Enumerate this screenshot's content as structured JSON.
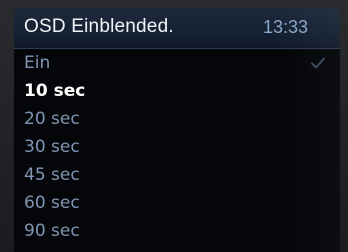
{
  "header": {
    "title": "OSD Einblended.",
    "time": "13:33"
  },
  "menu": {
    "items": [
      {
        "label": "Ein",
        "checked": true
      },
      {
        "label": "10 sec",
        "selected": true
      },
      {
        "label": "20 sec"
      },
      {
        "label": "30 sec"
      },
      {
        "label": "45 sec"
      },
      {
        "label": "60 sec"
      },
      {
        "label": "90 sec"
      }
    ]
  },
  "colors": {
    "header_bg": "#1e2a3c",
    "item_text": "#7f96b4",
    "selected_text": "#ffffff",
    "check_icon": "#3a4a60"
  },
  "icons": {
    "checked_item": "checkmark-icon"
  }
}
